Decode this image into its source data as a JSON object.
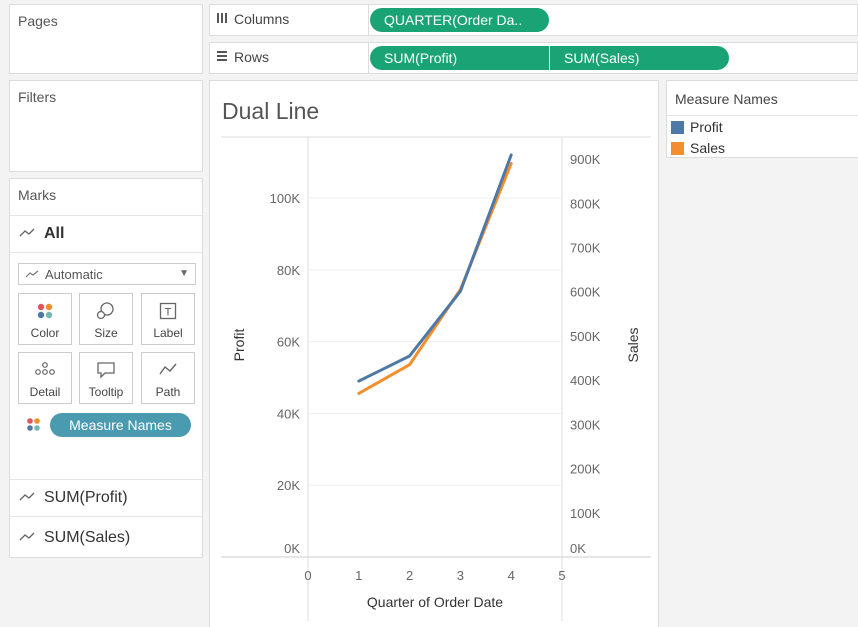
{
  "pages": {
    "title": "Pages"
  },
  "filters": {
    "title": "Filters"
  },
  "columns_shelf": {
    "label": "Columns",
    "pills": [
      "QUARTER(Order Da.."
    ]
  },
  "rows_shelf": {
    "label": "Rows",
    "pills": [
      "SUM(Profit)",
      "SUM(Sales)"
    ]
  },
  "marks": {
    "title": "Marks",
    "all_label": "All",
    "mark_type": "Automatic",
    "buttons": [
      "Color",
      "Size",
      "Label",
      "Detail",
      "Tooltip",
      "Path"
    ],
    "color_pill": "Measure Names",
    "sections": [
      "SUM(Profit)",
      "SUM(Sales)"
    ]
  },
  "legend": {
    "title": "Measure Names",
    "items": [
      {
        "label": "Profit",
        "color": "#4e79a7"
      },
      {
        "label": "Sales",
        "color": "#f28e2b"
      }
    ]
  },
  "chart_data": {
    "type": "line",
    "title": "Dual Line",
    "xlabel": "Quarter of Order Date",
    "ylabel": "Profit",
    "y2label": "Sales",
    "x_ticks": [
      "0",
      "1",
      "2",
      "3",
      "4",
      "5"
    ],
    "y_ticks": [
      "0K",
      "20K",
      "40K",
      "60K",
      "80K",
      "100K"
    ],
    "y2_ticks": [
      "0K",
      "100K",
      "200K",
      "300K",
      "400K",
      "500K",
      "600K",
      "700K",
      "800K",
      "900K"
    ],
    "xlim": [
      0,
      5
    ],
    "ylim": [
      0,
      117000
    ],
    "y2lim": [
      0,
      950000
    ],
    "x": [
      1,
      2,
      3,
      4
    ],
    "series": [
      {
        "name": "Profit",
        "axis": "left",
        "color": "#4e79a7",
        "values": [
          49000,
          56000,
          74000,
          112000
        ]
      },
      {
        "name": "Sales",
        "axis": "right",
        "color": "#f28e2b",
        "values": [
          370000,
          435000,
          605000,
          890000
        ]
      }
    ]
  }
}
